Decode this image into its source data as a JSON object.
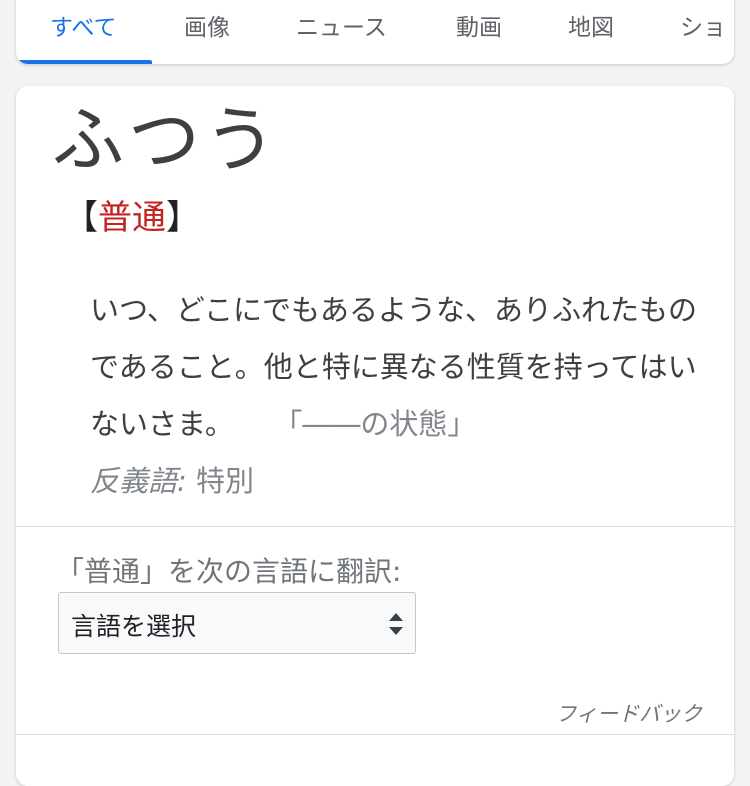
{
  "tabs": [
    {
      "label": "すべて",
      "active": true
    },
    {
      "label": "画像",
      "active": false
    },
    {
      "label": "ニュース",
      "active": false
    },
    {
      "label": "動画",
      "active": false
    },
    {
      "label": "地図",
      "active": false
    },
    {
      "label": "ショ",
      "active": false
    }
  ],
  "definition_card": {
    "headword": "ふつう",
    "kanji_open": "【",
    "kanji": "普通",
    "kanji_close": "】",
    "definition": "いつ、どこにでもあるような、ありふれたものであること。他と特に異なる性質を持ってはいないさま。",
    "example": "「――の状態」",
    "antonym_label": "反義語:",
    "antonym_value": "特別"
  },
  "translate": {
    "label": "「普通」を次の言語に翻訳:",
    "select_value": "言語を選択",
    "arrows_icon": "updown-arrows-icon"
  },
  "feedback_label": "フィードバック",
  "colors": {
    "accent": "#1a73e8",
    "kanji": "#c5221f",
    "muted": "#70757a"
  }
}
